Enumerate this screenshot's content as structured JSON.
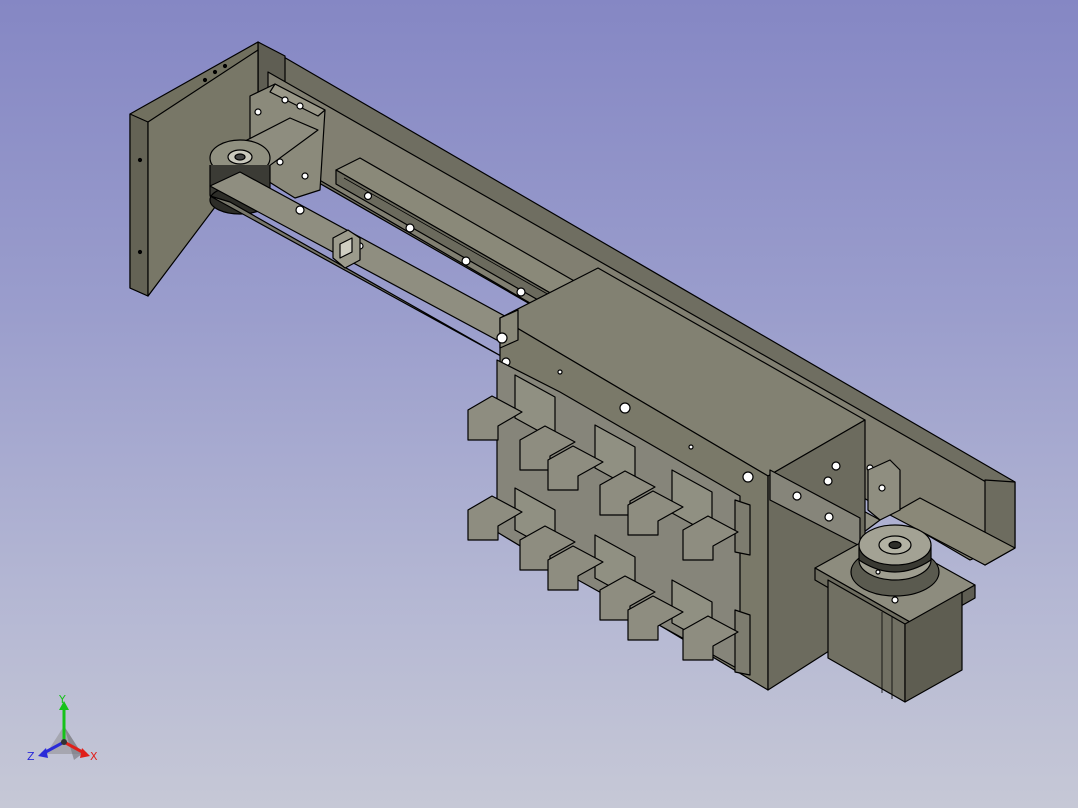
{
  "viewer": {
    "background_top": "#8587c4",
    "background_bottom": "#c6c8d6",
    "part_color": "#7f7e6f",
    "edge_color": "#000000"
  },
  "triad": {
    "x_label": "X",
    "y_label": "Y",
    "z_label": "Z",
    "x_color": "#e0201a",
    "y_color": "#16c21a",
    "z_color": "#2a2ad8"
  }
}
